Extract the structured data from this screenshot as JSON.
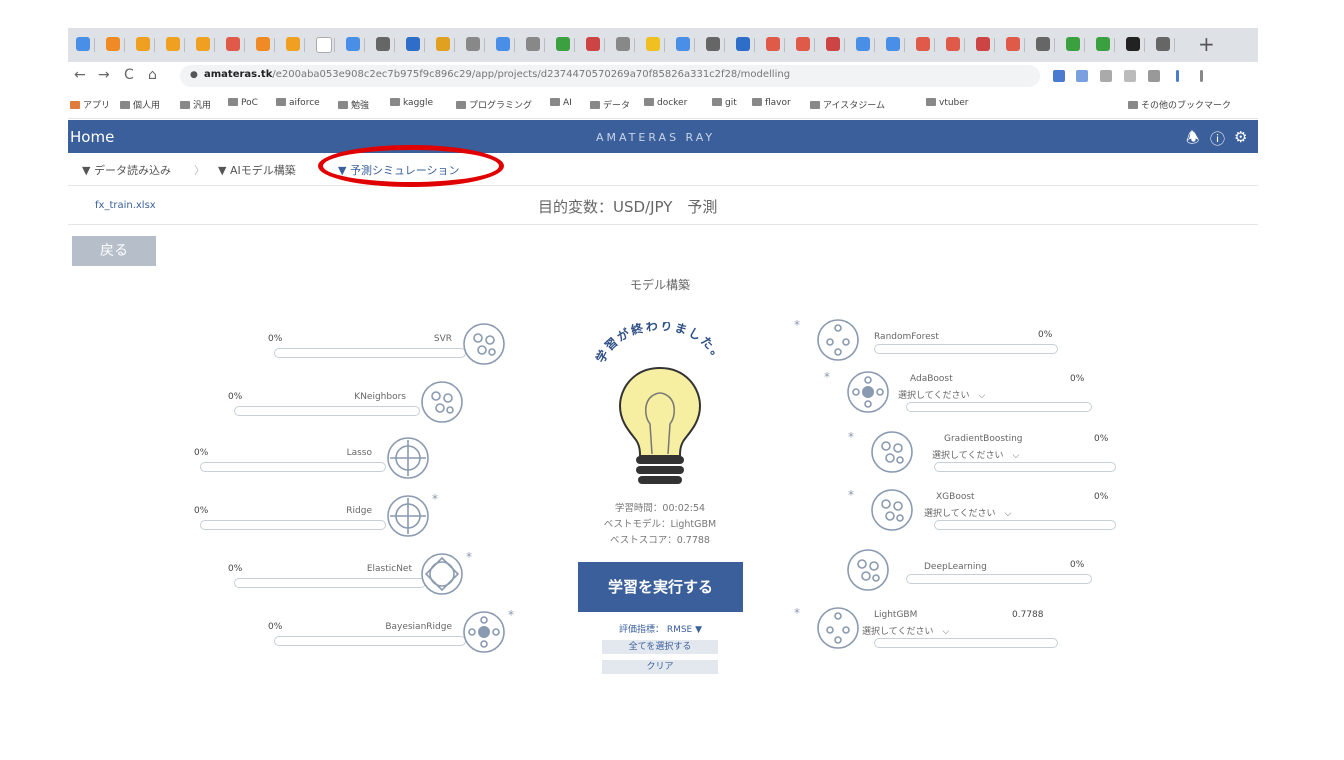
{
  "browser": {
    "url_host": "amateras.tk",
    "url_path": "/e200aba053e908c2ec7b975f9c896c29/app/projects/d2374470570269a70f85826a331c2f28/modelling",
    "new_tab_label": "+",
    "nav": {
      "back": "←",
      "forward": "→",
      "reload": "C",
      "home": "⌂"
    },
    "bookmarks": [
      "アプリ",
      "個人用",
      "汎用",
      "PoC",
      "aiforce",
      "勉強",
      "kaggle",
      "プログラミング",
      "AI",
      "データ",
      "docker",
      "git",
      "flavor",
      "アイスタジーム",
      "vtuber"
    ],
    "other_bookmarks": "その他のブックマーク"
  },
  "app": {
    "home": "Home",
    "brand": "AMATERAS RAY",
    "icons": {
      "bell": "bell-icon",
      "help": "help-icon",
      "settings": "gear-icon"
    }
  },
  "breadcrumb": {
    "step1": "▼ データ読み込み",
    "step2": "▼ AIモデル構築",
    "step3": "▼ 予測シミュレーション"
  },
  "file_name": "fx_train.xlsx",
  "target_variable": "目的変数：USD/JPY　予測",
  "back_button": "戻る",
  "section_title": "モデル構築",
  "left_models": [
    {
      "name": "SVR",
      "percent": "0%",
      "star": ""
    },
    {
      "name": "KNeighbors",
      "percent": "0%",
      "star": ""
    },
    {
      "name": "Lasso",
      "percent": "0%",
      "star": ""
    },
    {
      "name": "Ridge",
      "percent": "0%",
      "star": "*"
    },
    {
      "name": "ElasticNet",
      "percent": "0%",
      "star": "*"
    },
    {
      "name": "BayesianRidge",
      "percent": "0%",
      "star": "*"
    }
  ],
  "right_models": [
    {
      "name": "RandomForest",
      "percent": "0%",
      "star": "*",
      "select": ""
    },
    {
      "name": "AdaBoost",
      "percent": "0%",
      "star": "*",
      "select": "選択してください　⌵"
    },
    {
      "name": "GradientBoosting",
      "percent": "0%",
      "star": "*",
      "select": "選択してください　⌵"
    },
    {
      "name": "XGBoost",
      "percent": "0%",
      "star": "*",
      "select": "選択してください　⌵"
    },
    {
      "name": "DeepLearning",
      "percent": "0%",
      "star": "",
      "select": ""
    },
    {
      "name": "LightGBM",
      "percent": "0.7788",
      "star": "*",
      "select": "選択してください　⌵"
    }
  ],
  "center": {
    "done_message": "学習が終わりました。",
    "study_time": "学習時間：00:02:54",
    "best_model": "ベストモデル：LightGBM",
    "best_score": "ベストスコア：0.7788",
    "run_button": "学習を実行する",
    "metric": "評価指標：  RMSE ▼",
    "select_all": "全てを選択する",
    "clear": "クリア"
  },
  "colors": {
    "header": "#3a5f9b",
    "highlight": "#e00000",
    "bulb": "#f6eea0",
    "bulb_base": "#333333"
  }
}
